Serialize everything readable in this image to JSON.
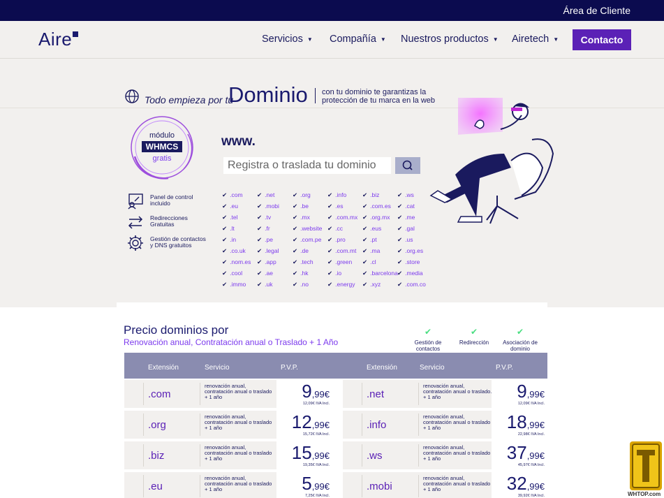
{
  "topbar": {
    "client_area": "Área de Cliente"
  },
  "brand": {
    "logo_text": "Aire"
  },
  "nav": {
    "items": [
      {
        "label": "Servicios"
      },
      {
        "label": "Compañía"
      },
      {
        "label": "Nuestros productos"
      },
      {
        "label": "Airetech"
      }
    ],
    "contact_label": "Contacto"
  },
  "hero": {
    "tagline": "Todo empieza por tu",
    "dominio": "Dominio",
    "subtag": "con tu dominio te garantizas la protección de tu marca en la web",
    "badge": {
      "modulo": "módulo",
      "whmcs": "WHMCS",
      "gratis": "gratis"
    },
    "features": [
      {
        "label": "Panel de control incluido",
        "icon": "control-panel-icon"
      },
      {
        "label": "Redirecciones Gratuitas",
        "icon": "arrows-icon"
      },
      {
        "label": "Gestión de contactos y DNS gratuitos",
        "icon": "gear-icon"
      }
    ],
    "www": "www.",
    "search_placeholder": "Registra o traslada tu dominio",
    "tld_columns": [
      [
        ".com",
        ".eu",
        ".tel",
        ".lt",
        ".in",
        ".co.uk",
        ".nom.es",
        ".cool",
        ".immo"
      ],
      [
        ".net",
        ".mobi",
        ".tv",
        ".fr",
        ".pe",
        ".legal",
        ".app",
        ".ae",
        ".uk"
      ],
      [
        ".org",
        ".be",
        ".mx",
        ".website",
        ".com.pe",
        ".de",
        ".tech",
        ".hk",
        ".no"
      ],
      [
        ".info",
        ".es",
        ".com.mx",
        ".cc",
        ".pro",
        ".com.mt",
        ".green",
        ".io",
        ".energy"
      ],
      [
        ".biz",
        ".com.es",
        ".org.mx",
        ".eus",
        ".pt",
        ".ma",
        ".cl",
        ".barcelona",
        ".xyz"
      ],
      [
        ".ws",
        ".cat",
        ".me",
        ".gal",
        ".us",
        ".org.es",
        ".store",
        ".media",
        ".com.co"
      ]
    ],
    "check_mark": "✔"
  },
  "pricing": {
    "title": "Precio dominios por",
    "subtitle": "Renovación anual, Contratación anual o Traslado + 1 Año",
    "features": [
      "Gestión de contactos",
      "Redirección",
      "Asociación de dominio"
    ],
    "tick": "✔",
    "headers": {
      "ext": "Extensión",
      "service": "Servicio",
      "price": "P.V.P."
    },
    "left_rows": [
      {
        "ext": ".com",
        "service": "renovación anual, contratación anual o traslado + 1 año",
        "int": "9",
        "dec": ",99€",
        "iva": "12,09€ IVA Incl."
      },
      {
        "ext": ".org",
        "service": "renovación anual, contratación anual o traslado + 1 año",
        "int": "12",
        "dec": ",99€",
        "iva": "15,72€ IVA Incl."
      },
      {
        "ext": ".biz",
        "service": "renovación anual, contratación anual o traslado + 1 año",
        "int": "15",
        "dec": ",99€",
        "iva": "19,35€ IVA Incl."
      },
      {
        "ext": ".eu",
        "service": "renovación anual, contratación anual o traslado + 1 año",
        "int": "5",
        "dec": ",99€",
        "iva": "7,25€ IVA Incl."
      }
    ],
    "right_rows": [
      {
        "ext": ".net",
        "service": "renovación anual, contratación anual o traslado. + 1 año",
        "int": "9",
        "dec": ",99€",
        "iva": "12,09€ IVA Incl."
      },
      {
        "ext": ".info",
        "service": "renovación anual, contratación anual o traslado + 1 año",
        "int": "18",
        "dec": ",99€",
        "iva": "22,98€ IVA Incl."
      },
      {
        "ext": ".ws",
        "service": "renovación anual, contratación anual o traslado + 1 año",
        "int": "37",
        "dec": ",99€",
        "iva": "45,97€ IVA Incl."
      },
      {
        "ext": ".mobi",
        "service": "renovación anual, contratación anual o traslado + 1 año",
        "int": "32",
        "dec": ",99€",
        "iva": "39,92€ IVA Incl."
      }
    ]
  },
  "watermark": {
    "text": "WHTOP.com"
  }
}
